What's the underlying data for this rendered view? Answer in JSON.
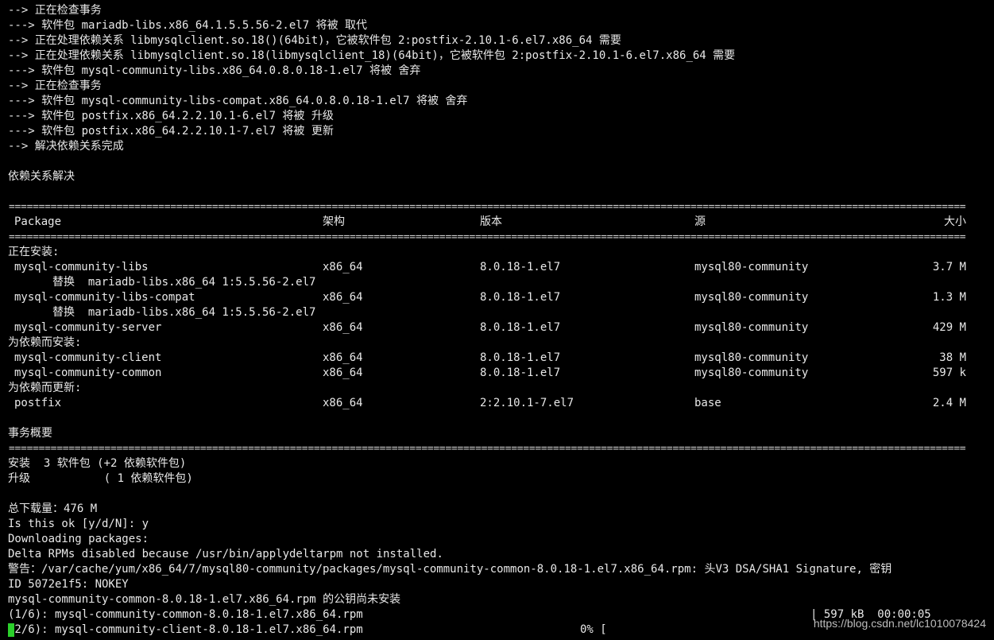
{
  "terminal": {
    "lines_top": [
      "--> 正在检查事务",
      "---> 软件包 mariadb-libs.x86_64.1.5.5.56-2.el7 将被 取代",
      "--> 正在处理依赖关系 libmysqlclient.so.18()(64bit)，它被软件包 2:postfix-2.10.1-6.el7.x86_64 需要",
      "--> 正在处理依赖关系 libmysqlclient.so.18(libmysqlclient_18)(64bit)，它被软件包 2:postfix-2.10.1-6.el7.x86_64 需要",
      "---> 软件包 mysql-community-libs.x86_64.0.8.0.18-1.el7 将被 舍弃",
      "--> 正在检查事务",
      "---> 软件包 mysql-community-libs-compat.x86_64.0.8.0.18-1.el7 将被 舍弃",
      "---> 软件包 postfix.x86_64.2.2.10.1-6.el7 将被 升级",
      "---> 软件包 postfix.x86_64.2.2.10.1-7.el7 将被 更新",
      "--> 解决依赖关系完成"
    ],
    "deps_resolved": "依赖关系解决",
    "separator": "================================================================================================================================================================",
    "table_header": {
      "package": "Package",
      "arch": "架构",
      "version": "版本",
      "repo": "源",
      "size": "大小"
    },
    "installing_label": "正在安装:",
    "rows_installing": [
      {
        "name": "mysql-community-libs",
        "arch": "x86_64",
        "version": "8.0.18-1.el7",
        "repo": "mysql80-community",
        "size": "3.7 M"
      },
      {
        "replace": "替换  mariadb-libs.x86_64 1:5.5.56-2.el7"
      },
      {
        "name": "mysql-community-libs-compat",
        "arch": "x86_64",
        "version": "8.0.18-1.el7",
        "repo": "mysql80-community",
        "size": "1.3 M"
      },
      {
        "replace": "替换  mariadb-libs.x86_64 1:5.5.56-2.el7"
      },
      {
        "name": "mysql-community-server",
        "arch": "x86_64",
        "version": "8.0.18-1.el7",
        "repo": "mysql80-community",
        "size": "429 M"
      }
    ],
    "dep_install_label": "为依赖而安装:",
    "rows_dep_install": [
      {
        "name": "mysql-community-client",
        "arch": "x86_64",
        "version": "8.0.18-1.el7",
        "repo": "mysql80-community",
        "size": "38 M"
      },
      {
        "name": "mysql-community-common",
        "arch": "x86_64",
        "version": "8.0.18-1.el7",
        "repo": "mysql80-community",
        "size": "597 k"
      }
    ],
    "dep_update_label": "为依赖而更新:",
    "rows_dep_update": [
      {
        "name": "postfix",
        "arch": "x86_64",
        "version": "2:2.10.1-7.el7",
        "repo": "base",
        "size": "2.4 M"
      }
    ],
    "summary_label": "事务概要",
    "summary_install": "安装  3 软件包 (+2 依赖软件包)",
    "summary_upgrade": "升级           ( 1 依赖软件包)",
    "total_download": "总下载量：476 M",
    "prompt": "Is this ok [y/d/N]: y",
    "downloading": "Downloading packages:",
    "delta_rpms": "Delta RPMs disabled because /usr/bin/applydeltarpm not installed.",
    "warning_line": "警告：/var/cache/yum/x86_64/7/mysql80-community/packages/mysql-community-common-8.0.18-1.el7.x86_64.rpm: 头V3 DSA/SHA1 Signature, 密钥",
    "warning_id": "ID 5072e1f5: NOKEY",
    "pubkey_line": "mysql-community-common-8.0.18-1.el7.x86_64.rpm 的公钥尚未安装",
    "progress_1": "(1/6): mysql-community-common-8.0.18-1.el7.x86_64.rpm",
    "progress_1_stats": "| 597 kB  00:00:05",
    "progress_2": "(2/6): mysql-community-client-8.0.18-1.el7.x86_64.rpm",
    "progress_2_pct": "0% [",
    "watermark": "https://blog.csdn.net/lc1010078424"
  },
  "colors": {
    "background": "#000000",
    "text": "#e8e8e8",
    "cursor": "#2bd02b"
  }
}
